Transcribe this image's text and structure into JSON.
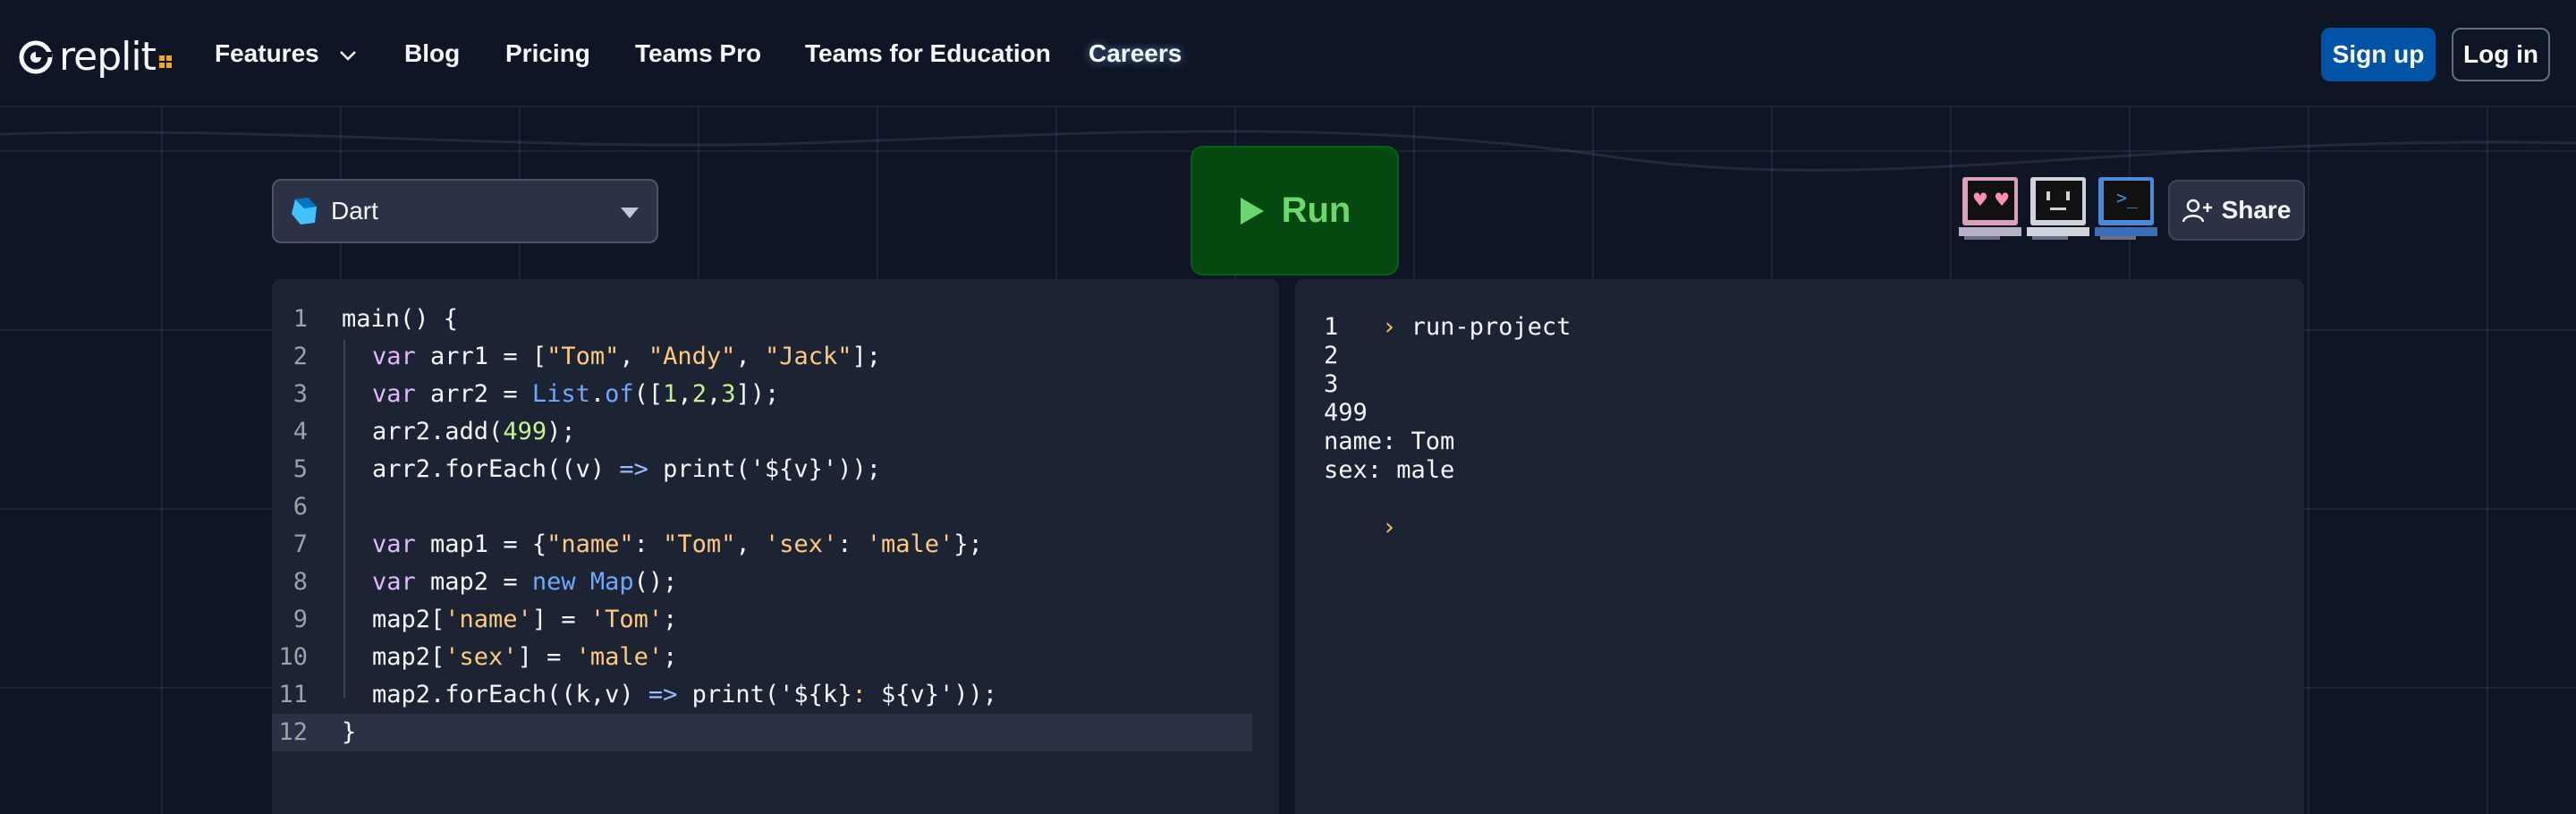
{
  "nav": {
    "logo": "replit",
    "items": [
      "Features",
      "Blog",
      "Pricing",
      "Teams Pro",
      "Teams for Education",
      "Careers"
    ],
    "signup": "Sign up",
    "login": "Log in"
  },
  "toolbar": {
    "language": "Dart",
    "run_label": "Run",
    "share_label": "Share"
  },
  "editor": {
    "lines": [
      "1",
      "2",
      "3",
      "4",
      "5",
      "6",
      "7",
      "8",
      "9",
      "10",
      "11",
      "12"
    ],
    "code": [
      [
        {
          "t": "main() {",
          "c": ""
        }
      ],
      [
        {
          "t": "var",
          "c": "kw"
        },
        {
          "t": " arr1 = [",
          "c": ""
        },
        {
          "t": "\"Tom\"",
          "c": "str"
        },
        {
          "t": ", ",
          "c": ""
        },
        {
          "t": "\"Andy\"",
          "c": "str"
        },
        {
          "t": ", ",
          "c": ""
        },
        {
          "t": "\"Jack\"",
          "c": "str"
        },
        {
          "t": "];",
          "c": ""
        }
      ],
      [
        {
          "t": "var",
          "c": "kw"
        },
        {
          "t": " arr2 = ",
          "c": ""
        },
        {
          "t": "List",
          "c": "fn"
        },
        {
          "t": ".",
          "c": ""
        },
        {
          "t": "of",
          "c": "fn"
        },
        {
          "t": "([",
          "c": ""
        },
        {
          "t": "1",
          "c": "num"
        },
        {
          "t": ",",
          "c": ""
        },
        {
          "t": "2",
          "c": "num"
        },
        {
          "t": ",",
          "c": ""
        },
        {
          "t": "3",
          "c": "num"
        },
        {
          "t": "]);",
          "c": ""
        }
      ],
      [
        {
          "t": "arr2.add(",
          "c": ""
        },
        {
          "t": "499",
          "c": "num"
        },
        {
          "t": ");",
          "c": ""
        }
      ],
      [
        {
          "t": "arr2.forEach((v) ",
          "c": ""
        },
        {
          "t": "=>",
          "c": "op"
        },
        {
          "t": " print(",
          "c": ""
        },
        {
          "t": "'${v}'",
          "c": ""
        },
        {
          "t": "));",
          "c": ""
        }
      ],
      [
        {
          "t": "",
          "c": ""
        }
      ],
      [
        {
          "t": "var",
          "c": "kw"
        },
        {
          "t": " map1 = {",
          "c": ""
        },
        {
          "t": "\"name\"",
          "c": "str"
        },
        {
          "t": ": ",
          "c": ""
        },
        {
          "t": "\"Tom\"",
          "c": "str"
        },
        {
          "t": ", ",
          "c": ""
        },
        {
          "t": "'sex'",
          "c": "str"
        },
        {
          "t": ": ",
          "c": ""
        },
        {
          "t": "'male'",
          "c": "str"
        },
        {
          "t": "};",
          "c": ""
        }
      ],
      [
        {
          "t": "var",
          "c": "kw"
        },
        {
          "t": " map2 = ",
          "c": ""
        },
        {
          "t": "new",
          "c": "fn"
        },
        {
          "t": " ",
          "c": ""
        },
        {
          "t": "Map",
          "c": "fn"
        },
        {
          "t": "();",
          "c": ""
        }
      ],
      [
        {
          "t": "map2[",
          "c": ""
        },
        {
          "t": "'name'",
          "c": "str"
        },
        {
          "t": "] = ",
          "c": ""
        },
        {
          "t": "'Tom'",
          "c": "str"
        },
        {
          "t": ";",
          "c": ""
        }
      ],
      [
        {
          "t": "map2[",
          "c": ""
        },
        {
          "t": "'sex'",
          "c": "str"
        },
        {
          "t": "] = ",
          "c": ""
        },
        {
          "t": "'male'",
          "c": "str"
        },
        {
          "t": ";",
          "c": ""
        }
      ],
      [
        {
          "t": "map2.forEach((k,v) ",
          "c": ""
        },
        {
          "t": "=>",
          "c": "op"
        },
        {
          "t": " print(",
          "c": ""
        },
        {
          "t": "'${k}",
          "c": ""
        },
        {
          "t": ":",
          "c": "str"
        },
        {
          "t": " ${v}'",
          "c": ""
        },
        {
          "t": "));",
          "c": ""
        }
      ],
      [
        {
          "t": "}",
          "c": ""
        }
      ]
    ]
  },
  "console": {
    "command": "run-project",
    "output": [
      "1",
      "2",
      "3",
      "499",
      "name: Tom",
      "sex: male"
    ]
  },
  "colors": {
    "background": "#0e1525",
    "panel": "#1c2333",
    "run_bg": "#044a10",
    "run_text": "#6ed66e",
    "signup_bg": "#0053a6",
    "dart_blue": "#40c4ff"
  },
  "icons": [
    "replit-logo-icon",
    "chevron-down-icon",
    "dart-logo-icon",
    "caret-down-icon",
    "play-icon",
    "user-plus-icon",
    "monitor-avatar-icon"
  ]
}
